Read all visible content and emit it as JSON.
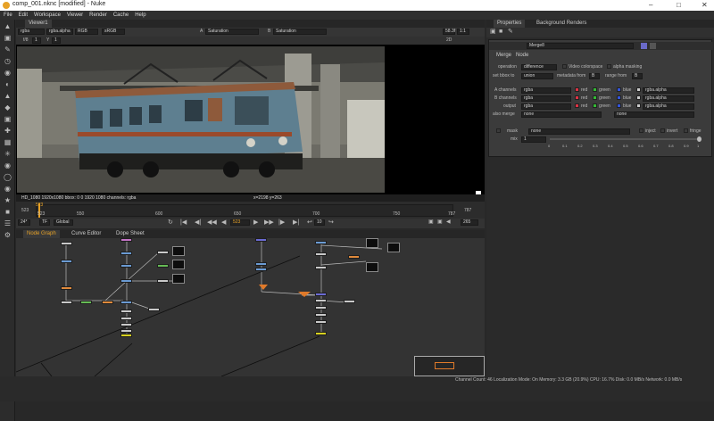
{
  "window": {
    "title": "comp_001.nknc [modified] - Nuke"
  },
  "menubar": {
    "items": [
      "File",
      "Edit",
      "Workspace",
      "Viewer",
      "Render",
      "Cache",
      "Help"
    ]
  },
  "viewer": {
    "tab": "Viewer1",
    "channels": "rgba",
    "layer": "rgba.alpha",
    "colorspace": "RGB",
    "display": "sRGB",
    "input_a": "Saturation",
    "input_b": "Saturation",
    "fps": "58.3f",
    "zoom": "1:1",
    "mode_2d": "2D",
    "gain_label": "f/8",
    "gain": "1",
    "gamma_label": "Y",
    "gamma": "1",
    "status": "HD_1080 1920x1080  bbox: 0 0 1920 1080 channels: rgba",
    "coords": "x=2198 y=263"
  },
  "timeline": {
    "start": "523",
    "end": "787",
    "current": "523",
    "ticks": [
      "523",
      "550",
      "600",
      "650",
      "700",
      "750",
      "787"
    ],
    "fps": "24*",
    "tf": "TF",
    "scope": "Global",
    "frame_field": "523",
    "step": "10",
    "end_field": "265"
  },
  "graph": {
    "tabs": [
      "Node Graph",
      "Curve Editor",
      "Dope Sheet"
    ]
  },
  "properties": {
    "tabs": [
      "Properties",
      "Background Renders"
    ],
    "node_name": "Merge8",
    "subtabs": [
      "Merge",
      "Node"
    ],
    "operation_label": "operation",
    "operation": "difference",
    "video_colorspace": "Video colorspace",
    "alpha_masking": "alpha masking",
    "bbox_label": "set bbox to",
    "bbox": "union",
    "metadata_label": "metadata from",
    "metadata": "B",
    "range_label": "range from",
    "range": "B",
    "a_channels_label": "A channels",
    "b_channels_label": "B channels",
    "output_label": "output",
    "channels_value": "rgba",
    "red": "red",
    "green": "green",
    "blue": "blue",
    "alpha_value": "rgba.alpha",
    "also_merge_label": "also merge",
    "also_merge": "none",
    "also_merge_b": "none",
    "mask_label": "mask",
    "mask": "none",
    "inject": "inject",
    "invert": "invert",
    "fringe": "fringe",
    "mix_label": "mix",
    "mix": "1",
    "slider_ticks": [
      "0",
      "0.1",
      "0.2",
      "0.3",
      "0.4",
      "0.5",
      "0.6",
      "0.7",
      "0.8",
      "0.9",
      "1"
    ]
  },
  "statusbar": {
    "text": "Channel Count: 46  Localization Mode: On  Memory: 3.3 GB (20.9%)  CPU: 16.7%  Disk: 0.0 MB/s  Network: 0.0 MB/s"
  },
  "colors": {
    "accent": "#e7a227",
    "timeline_marker": "#e7a227",
    "yellow_node": "#d7d11f"
  }
}
